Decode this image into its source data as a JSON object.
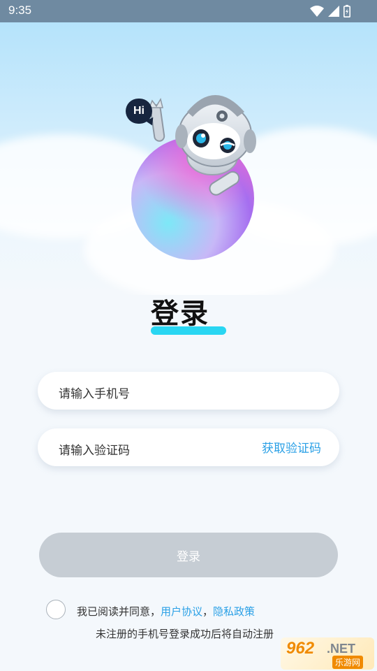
{
  "status_bar": {
    "time": "9:35"
  },
  "hero": {
    "bubble_text": "Hi"
  },
  "page": {
    "title": "登录"
  },
  "form": {
    "phone_placeholder": "请输入手机号",
    "code_placeholder": "请输入验证码",
    "get_code_label": "获取验证码",
    "login_label": "登录"
  },
  "agreement": {
    "prefix": "我已阅读并同意，",
    "user_agreement": "用户协议",
    "separator": "，",
    "privacy_policy": "隐私政策",
    "note": "未注册的手机号登录成功后将自动注册"
  },
  "watermark": {
    "number": "962",
    "suffix": ".NET",
    "text": "乐游网"
  },
  "colors": {
    "accent": "#2aa0e6",
    "underline": "#29d6f2",
    "button_disabled": "#c6cdd4"
  }
}
